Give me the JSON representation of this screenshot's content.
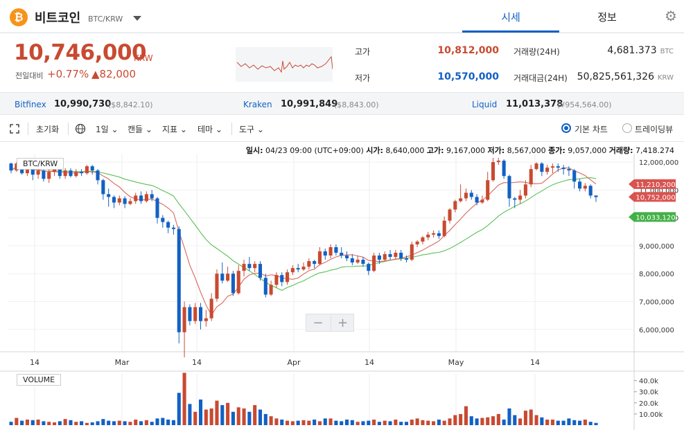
{
  "header": {
    "coin_icon": "bitcoin-icon",
    "coin_symbol": "₿",
    "coin_name": "비트코인",
    "pair": "BTC/KRW",
    "tabs": [
      {
        "label": "시세",
        "active": true
      },
      {
        "label": "정보",
        "active": false
      }
    ],
    "settings_icon": "gear-icon"
  },
  "price": {
    "current": "10,746,000",
    "unit": "KRW",
    "change_label": "전일대비",
    "change_pct": "+0.77%",
    "change_amount": "▲82,000"
  },
  "stats": {
    "high_label": "고가",
    "high": "10,812,000",
    "low_label": "저가",
    "low": "10,570,000",
    "volume_label": "거래량(24H)",
    "volume": "4,681.373",
    "volume_unit": "BTC",
    "turnover_label": "거래대금(24H)",
    "turnover": "50,825,561,326",
    "turnover_unit": "KRW"
  },
  "exchanges": [
    {
      "name": "Bitfinex",
      "price": "10,990,730",
      "foreign": "($8,842.10)"
    },
    {
      "name": "Kraken",
      "price": "10,991,849",
      "foreign": "($8,843.00)"
    },
    {
      "name": "Liquid",
      "price": "11,013,378",
      "foreign": "(¥954,564.00)"
    }
  ],
  "toolbar": {
    "expand_icon": "expand-icon",
    "reset": "초기화",
    "globe_icon": "globe-icon",
    "interval": "1일",
    "candle": "캔들",
    "indicator": "지표",
    "theme": "테마",
    "tools": "도구",
    "basic_chart": "기본 차트",
    "tradingview": "트레이딩뷰",
    "basic_selected": true
  },
  "chart_info": {
    "date_label": "일시:",
    "date": "04/23 09:00 (UTC+09:00)",
    "open_label": "시가:",
    "open": "8,640,000",
    "high_label": "고가:",
    "high": "9,167,000",
    "low_label": "저가:",
    "low": "8,567,000",
    "close_label": "종가:",
    "close": "9,057,000",
    "volume_label": "거래량:",
    "volume": "7,418.274",
    "pair_tag": "BTC/KRW",
    "volume_tag": "VOLUME",
    "zoom_out": "−",
    "zoom_in": "+"
  },
  "colors": {
    "up": "#c84a31",
    "down": "#1261c4",
    "ma_short": "#d9685a",
    "ma_long": "#5bbf57",
    "accent": "#1261c4"
  },
  "chart_data": {
    "type": "candlestick",
    "x_tick_labels": [
      "14",
      "Mar",
      "14",
      "Apr",
      "14",
      "May",
      "14"
    ],
    "y_tick_labels": [
      "12,000,000",
      "11,000,000",
      "10,000,000",
      "9,000,000",
      "8,000,000",
      "7,000,000",
      "6,000,000"
    ],
    "ylim": [
      5200000,
      12300000
    ],
    "price_tags": [
      {
        "label": "11,210,200",
        "value": 11210200,
        "color": "#d9534f"
      },
      {
        "label": "10,752,000",
        "value": 10752000,
        "color": "#d9534f"
      },
      {
        "label": "10,033,120",
        "value": 10033120,
        "color": "#43b047"
      }
    ],
    "vol_tick_labels": [
      "40.0k",
      "30.0k",
      "20.0k",
      "10.00k"
    ],
    "vol_ylim": [
      0,
      46000
    ],
    "candles": [
      [
        11950000,
        11700000,
        11980000,
        11600000
      ],
      [
        11700000,
        11950000,
        12000000,
        11650000
      ],
      [
        11950000,
        11600000,
        12050000,
        11550000
      ],
      [
        11600000,
        11850000,
        11900000,
        11500000
      ],
      [
        11850000,
        11550000,
        11900000,
        11350000
      ],
      [
        11550000,
        11700000,
        11800000,
        11400000
      ],
      [
        11700000,
        11400000,
        11850000,
        11300000
      ],
      [
        11400000,
        11650000,
        11750000,
        11250000
      ],
      [
        11650000,
        11850000,
        11950000,
        11500000
      ],
      [
        11850000,
        11500000,
        12000000,
        11400000
      ],
      [
        11500000,
        11700000,
        11780000,
        11400000
      ],
      [
        11700000,
        11500000,
        11780000,
        11450000
      ],
      [
        11500000,
        11650000,
        11750000,
        11450000
      ],
      [
        11650000,
        11600000,
        11750000,
        11500000
      ],
      [
        11600000,
        11850000,
        11900000,
        11550000
      ],
      [
        11850000,
        11700000,
        11900000,
        11550000
      ],
      [
        11700000,
        11350000,
        11750000,
        11200000
      ],
      [
        11350000,
        10850000,
        11400000,
        10650000
      ],
      [
        10850000,
        10750000,
        11050000,
        10400000
      ],
      [
        10750000,
        10550000,
        10800000,
        10350000
      ],
      [
        10550000,
        10700000,
        10800000,
        10450000
      ],
      [
        10700000,
        10500000,
        10780000,
        10350000
      ],
      [
        10500000,
        10600000,
        10700000,
        10450000
      ],
      [
        10600000,
        10800000,
        10900000,
        10500000
      ],
      [
        10800000,
        10600000,
        10950000,
        10500000
      ],
      [
        10600000,
        10850000,
        10950000,
        10550000
      ],
      [
        10850000,
        10700000,
        11000000,
        10600000
      ],
      [
        10700000,
        10000000,
        10750000,
        9800000
      ],
      [
        10000000,
        9850000,
        10100000,
        9650000
      ],
      [
        9850000,
        9650000,
        9900000,
        9450000
      ],
      [
        9650000,
        9600000,
        9750000,
        9400000
      ],
      [
        9600000,
        5900000,
        9700000,
        5500000
      ],
      [
        5900000,
        6800000,
        7000000,
        5000000
      ],
      [
        6800000,
        6300000,
        6900000,
        6150000
      ],
      [
        6300000,
        6800000,
        6950000,
        6200000
      ],
      [
        6800000,
        6300000,
        6950000,
        6000000
      ],
      [
        6300000,
        6400000,
        6700000,
        6100000
      ],
      [
        6400000,
        7100000,
        7300000,
        6300000
      ],
      [
        7100000,
        8000000,
        8150000,
        7000000
      ],
      [
        8000000,
        7750000,
        8400000,
        7650000
      ],
      [
        7750000,
        8000000,
        8250000,
        7700000
      ],
      [
        8000000,
        7300000,
        8100000,
        7200000
      ],
      [
        7300000,
        8100000,
        8300000,
        7250000
      ],
      [
        8100000,
        8350000,
        8500000,
        7900000
      ],
      [
        8350000,
        8200000,
        8600000,
        8100000
      ],
      [
        8200000,
        8350000,
        8450000,
        8050000
      ],
      [
        8350000,
        7850000,
        8450000,
        7750000
      ],
      [
        7850000,
        7250000,
        8000000,
        7150000
      ],
      [
        7250000,
        7600000,
        7750000,
        7200000
      ],
      [
        7600000,
        7950000,
        8050000,
        7500000
      ],
      [
        7950000,
        7700000,
        8050000,
        7550000
      ],
      [
        7700000,
        8050000,
        8150000,
        7600000
      ],
      [
        8050000,
        8200000,
        8300000,
        7950000
      ],
      [
        8200000,
        8150000,
        8350000,
        8050000
      ],
      [
        8150000,
        8250000,
        8400000,
        8100000
      ],
      [
        8250000,
        8450000,
        8550000,
        8150000
      ],
      [
        8450000,
        8350000,
        8500000,
        8200000
      ],
      [
        8350000,
        8800000,
        8950000,
        8300000
      ],
      [
        8800000,
        8650000,
        8900000,
        8500000
      ],
      [
        8650000,
        8950000,
        9050000,
        8550000
      ],
      [
        8950000,
        8750000,
        9050000,
        8650000
      ],
      [
        8750000,
        8650000,
        8950000,
        8550000
      ],
      [
        8650000,
        8550000,
        8800000,
        8450000
      ],
      [
        8550000,
        8400000,
        8700000,
        8300000
      ],
      [
        8400000,
        8500000,
        8650000,
        8350000
      ],
      [
        8500000,
        8350000,
        8600000,
        8250000
      ],
      [
        8350000,
        8100000,
        8400000,
        7950000
      ],
      [
        8100000,
        8650000,
        8750000,
        8050000
      ],
      [
        8650000,
        8500000,
        8750000,
        8350000
      ],
      [
        8500000,
        8700000,
        8800000,
        8450000
      ],
      [
        8700000,
        8600000,
        8850000,
        8500000
      ],
      [
        8600000,
        8750000,
        8850000,
        8500000
      ],
      [
        8750000,
        8550000,
        8850000,
        8450000
      ],
      [
        8550000,
        8500000,
        8650000,
        8400000
      ],
      [
        8500000,
        9050000,
        9150000,
        8450000
      ],
      [
        9050000,
        9150000,
        9200000,
        8950000
      ],
      [
        9150000,
        9300000,
        9350000,
        9050000
      ],
      [
        9300000,
        9400000,
        9500000,
        9200000
      ],
      [
        9400000,
        9450000,
        9550000,
        9300000
      ],
      [
        9450000,
        9350000,
        9550000,
        9250000
      ],
      [
        9350000,
        9900000,
        10050000,
        9300000
      ],
      [
        9900000,
        10300000,
        10350000,
        9800000
      ],
      [
        10300000,
        10600000,
        10650000,
        10200000
      ],
      [
        10600000,
        10700000,
        11200000,
        10550000
      ],
      [
        10700000,
        10900000,
        11050000,
        10600000
      ],
      [
        10900000,
        10750000,
        11000000,
        10650000
      ],
      [
        10750000,
        10550000,
        10850000,
        10450000
      ],
      [
        10550000,
        10650000,
        10800000,
        10500000
      ],
      [
        10650000,
        11350000,
        11650000,
        10600000
      ],
      [
        11350000,
        12000000,
        12150000,
        11300000
      ],
      [
        12000000,
        12050000,
        12150000,
        11900000
      ],
      [
        12050000,
        11500000,
        12100000,
        11400000
      ],
      [
        11500000,
        10700000,
        11550000,
        10400000
      ],
      [
        10700000,
        10650000,
        10750000,
        10350000
      ],
      [
        10650000,
        10800000,
        11000000,
        10500000
      ],
      [
        10800000,
        11200000,
        11350000,
        10700000
      ],
      [
        11200000,
        11750000,
        11900000,
        11100000
      ],
      [
        11750000,
        11950000,
        12000000,
        11700000
      ],
      [
        11950000,
        11650000,
        12000000,
        11500000
      ],
      [
        11650000,
        11800000,
        11900000,
        11550000
      ],
      [
        11800000,
        11850000,
        11950000,
        11600000
      ],
      [
        11850000,
        11800000,
        11950000,
        11650000
      ],
      [
        11800000,
        11750000,
        11900000,
        11550000
      ],
      [
        11750000,
        11700000,
        11850000,
        11500000
      ],
      [
        11700000,
        11300000,
        11750000,
        11050000
      ],
      [
        11300000,
        11050000,
        11400000,
        10950000
      ],
      [
        11050000,
        11150000,
        11250000,
        10950000
      ],
      [
        11150000,
        10800000,
        11200000,
        10700000
      ],
      [
        10800000,
        10746000,
        10812000,
        10570000
      ]
    ],
    "volumes": [
      3000,
      6500,
      4000,
      5000,
      4500,
      5000,
      3500,
      3000,
      2500,
      3500,
      5500,
      4500,
      3000,
      3500,
      2000,
      2500,
      3500,
      5500,
      4000,
      3500,
      4000,
      3500,
      3000,
      5000,
      3500,
      4500,
      3000,
      6000,
      6500,
      5000,
      4500,
      29000,
      47000,
      19000,
      12000,
      23000,
      14000,
      15000,
      22000,
      18000,
      20000,
      12000,
      16000,
      15000,
      12000,
      18000,
      14000,
      10000,
      8000,
      6000,
      5000,
      4000,
      3500,
      4000,
      4500,
      4000,
      5000,
      3500,
      6000,
      6000,
      4000,
      3500,
      5000,
      4500,
      3000,
      3500,
      4000,
      5000,
      3000,
      4000,
      3500,
      5000,
      3000,
      3000,
      5000,
      6000,
      4500,
      4000,
      3500,
      5000,
      4000,
      6000,
      9000,
      10000,
      17000,
      8000,
      6000,
      6500,
      7000,
      8000,
      10000,
      5000,
      15000,
      9000,
      6000,
      13000,
      14000,
      9000,
      7000,
      5000,
      5000,
      4000,
      4000,
      6000,
      4500,
      4000,
      5000,
      3000,
      2000
    ]
  }
}
